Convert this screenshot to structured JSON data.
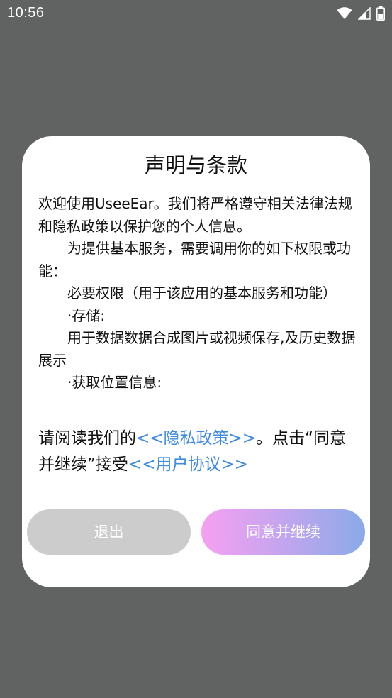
{
  "status_bar": {
    "time": "10:56",
    "icons": [
      "wifi-icon",
      "cellular-signal-icon",
      "battery-icon"
    ]
  },
  "dialog": {
    "title": "声明与条款",
    "terms": [
      {
        "text": "欢迎使用UseeEar。我们将严格遵守相关法律法规和隐私政策以保护您的个人信息。",
        "indent": false
      },
      {
        "text": "为提供基本服务，需要调用你的如下权限或功能：",
        "indent": true
      },
      {
        "text": "必要权限（用于该应用的基本服务和功能）",
        "indent": true
      },
      {
        "text": "·存储:",
        "indent": true
      },
      {
        "text": "用于数据数据合成图片或视频保存,及历史数据展示",
        "indent": true
      },
      {
        "text": "·获取位置信息:",
        "indent": true
      }
    ],
    "notice": {
      "part1": "请阅读我们的",
      "privacy_link": "<<隐私政策>>",
      "part2": "。点击“同意并继续”接受",
      "agreement_link": "<<用户协议>>"
    },
    "buttons": {
      "exit": "退出",
      "agree": "同意并继续"
    }
  },
  "colors": {
    "backdrop": "#616362",
    "dialog_bg": "#ffffff",
    "link": "#3f8be0",
    "exit_button": "#cccccc",
    "agree_gradient": [
      "#f6a0f0",
      "#8aaae8"
    ]
  }
}
